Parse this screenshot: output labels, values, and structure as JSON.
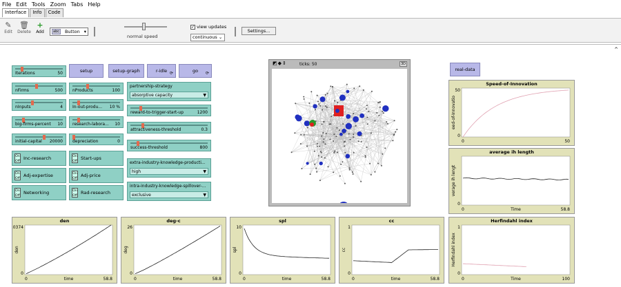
{
  "menu": [
    "File",
    "Edit",
    "Tools",
    "Zoom",
    "Tabs",
    "Help"
  ],
  "tabs": [
    "Interface",
    "Info",
    "Code"
  ],
  "toolbar": {
    "edit": "Edit",
    "delete": "Delete",
    "add": "Add",
    "widget_type": "Button",
    "speed_label": "normal speed",
    "view_updates": "view updates",
    "update_mode": "continuous",
    "settings": "Settings..."
  },
  "buttons": {
    "setup": "setup",
    "setup_graph": "setup-graph",
    "r_idle": "r-idle",
    "go": "go",
    "real_data": "real-data"
  },
  "sliders": [
    {
      "name": "iterations",
      "label": "Iterations",
      "value": "50",
      "pos": 0.12
    },
    {
      "name": "nfirms",
      "label": "nFirms",
      "value": "500",
      "pos": 0.45
    },
    {
      "name": "nproducts",
      "label": "nProducts",
      "value": "100",
      "pos": 0.3
    },
    {
      "name": "ninputs",
      "label": "nInputs",
      "value": "4",
      "pos": 0.35
    },
    {
      "name": "in-out-product",
      "label": "In-out-produ...",
      "value": "10 %",
      "pos": 0.1
    },
    {
      "name": "big-firms-percent",
      "label": "big-firms-percent",
      "value": "10",
      "pos": 0.15
    },
    {
      "name": "research-laboratory",
      "label": "research-labora...",
      "value": "10",
      "pos": 0.1
    },
    {
      "name": "initial-capital",
      "label": "initial-capital",
      "value": "20000",
      "pos": 0.62
    },
    {
      "name": "depreciation",
      "label": "depreciation",
      "value": "0",
      "pos": 0.0
    },
    {
      "name": "reward-to-trigger-start-up",
      "label": "reward-to-trigger-start-up",
      "value": "1200",
      "pos": 0.12
    },
    {
      "name": "attractiveness-threshold",
      "label": "attractiveness-threshold",
      "value": "0.3",
      "pos": 0.15
    },
    {
      "name": "success-threshold",
      "label": "success-threshold",
      "value": "800",
      "pos": 0.08
    }
  ],
  "choosers": [
    {
      "label": "partnership-strategy",
      "value": "absorptive capacity"
    },
    {
      "label": "extra-industry-knowledge-producti...",
      "value": "high"
    },
    {
      "label": "intra-industry-knowledge-spillover-...",
      "value": "exclusive"
    }
  ],
  "switches": [
    {
      "label": "Inc-research",
      "on": "On",
      "off": "Off"
    },
    {
      "label": "Start-ups",
      "on": "On",
      "off": "Off"
    },
    {
      "label": "Adj-expertise",
      "on": "On",
      "off": "Off"
    },
    {
      "label": "Adj-price",
      "on": "On",
      "off": "Off"
    },
    {
      "label": "Networking",
      "on": "On",
      "off": "Off"
    },
    {
      "label": "Rad-research",
      "on": "On",
      "off": "Off"
    }
  ],
  "view": {
    "ticks_label": "ticks: 50",
    "three_d": "3D"
  },
  "plots": [
    {
      "id": "speed",
      "title": "Speed-of-Innovation",
      "ylabel": "eed-of-Innovatio",
      "xlabel": "",
      "xmin": "0",
      "xmax": "50",
      "ymin": "0",
      "ymax": "50",
      "color": "#e0a0b0"
    },
    {
      "id": "avg",
      "title": "average ih length",
      "ylabel": "verage ih lengt",
      "xlabel": "Time",
      "xmin": "0",
      "xmax": "58.8",
      "ymin": "0",
      "ymax": "",
      "color": "#222"
    },
    {
      "id": "den",
      "title": "den",
      "ylabel": "den",
      "xlabel": "time",
      "xmin": "0",
      "xmax": "58.8",
      "ymin": "0",
      "ymax": "0.0374",
      "color": "#222"
    },
    {
      "id": "degc",
      "title": "deg-c",
      "ylabel": "deg",
      "xlabel": "time",
      "xmin": "0",
      "xmax": "58.8",
      "ymin": "0",
      "ymax": "26",
      "color": "#222"
    },
    {
      "id": "spl",
      "title": "spl",
      "ylabel": "spl",
      "xlabel": "time",
      "xmin": "0",
      "xmax": "58.8",
      "ymin": "0",
      "ymax": "10",
      "color": "#222"
    },
    {
      "id": "cc",
      "title": "cc",
      "ylabel": "cc",
      "xlabel": "time",
      "xmin": "0",
      "xmax": "58.8",
      "ymin": "0",
      "ymax": "1",
      "color": "#222"
    },
    {
      "id": "herf",
      "title": "Herfindahl index",
      "ylabel": "Herfindahl index",
      "xlabel": "Time",
      "xmin": "0",
      "xmax": "100",
      "ymin": "0",
      "ymax": "1",
      "color": "#e0a0b0"
    }
  ]
}
